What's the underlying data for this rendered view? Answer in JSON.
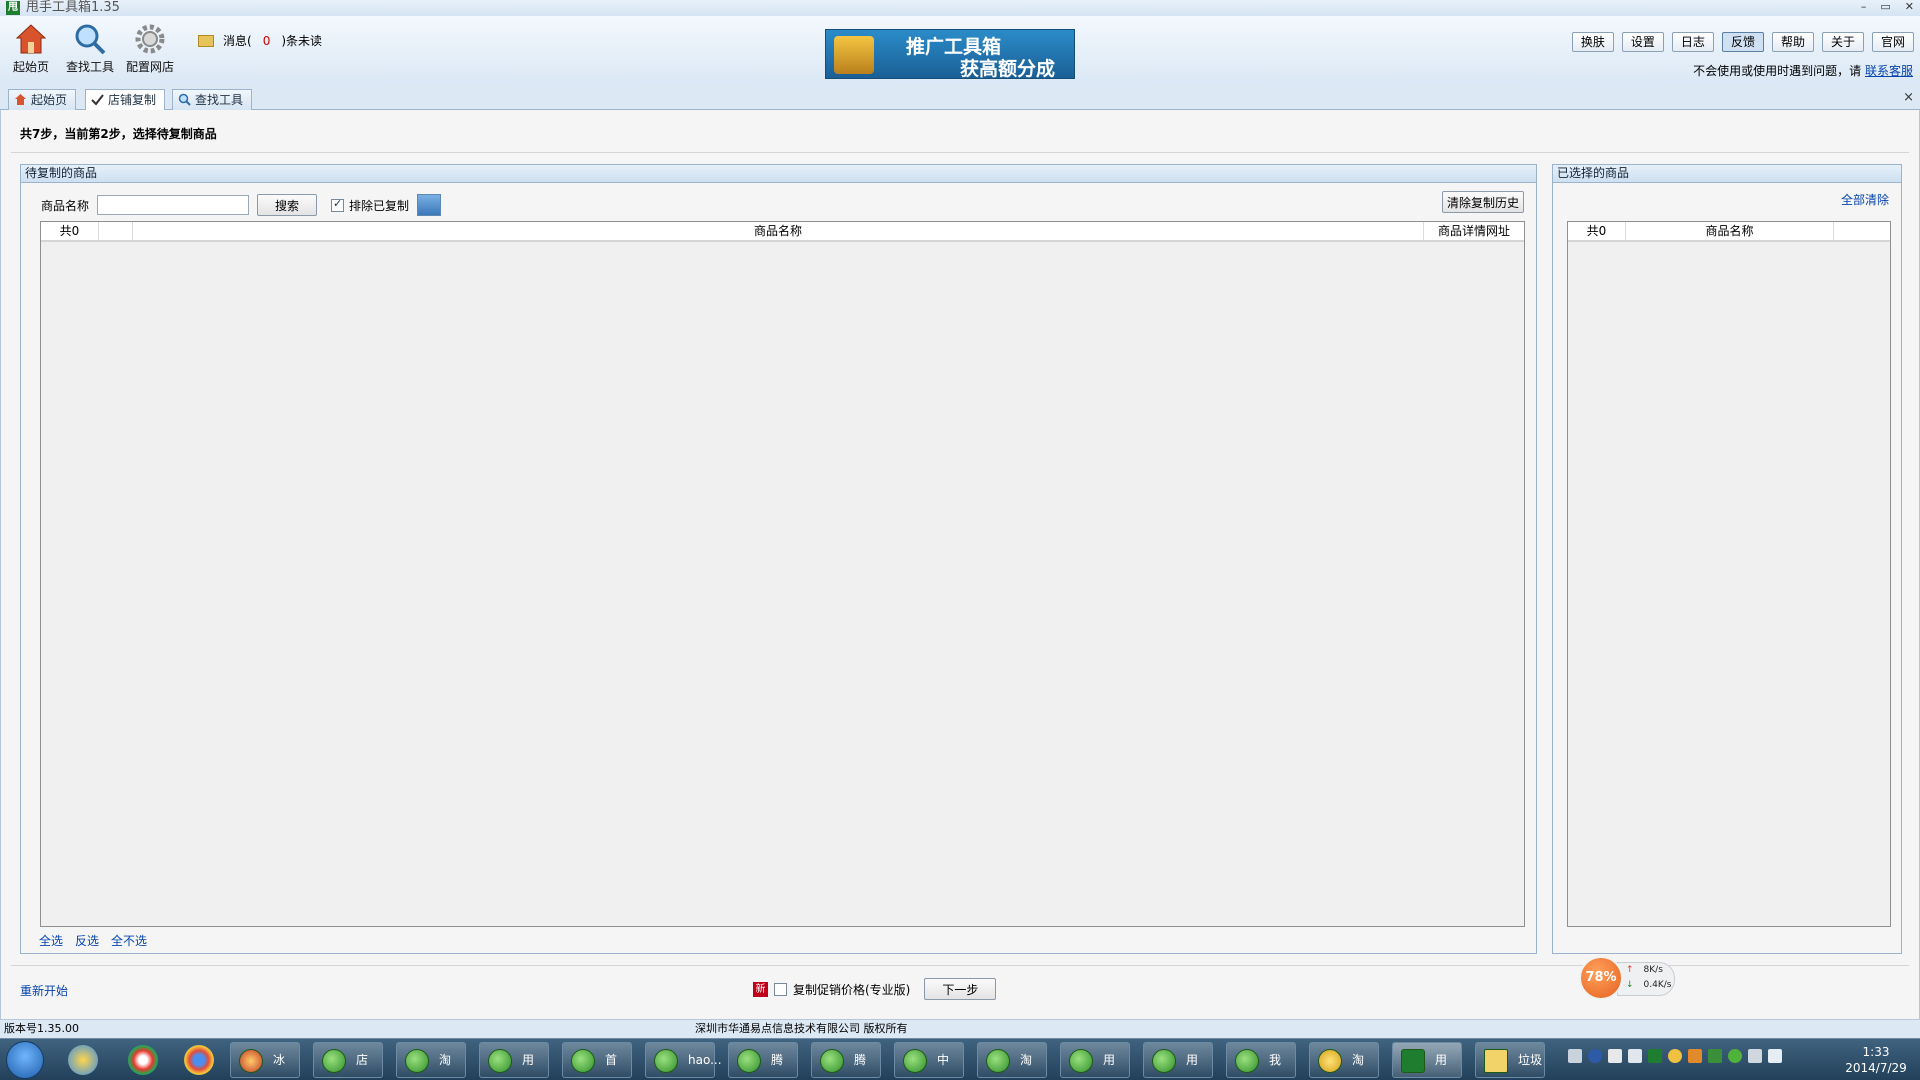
{
  "window": {
    "title": "甩手工具箱1.35",
    "logo_char": "甩",
    "minimize": "–",
    "maximize": "▭",
    "close": "✕"
  },
  "toolbar": {
    "home": "起始页",
    "find_tools": "查找工具",
    "config_shop": "配置网店",
    "msg_prefix": "消息(",
    "msg_count": "0",
    "msg_suffix": ")条未读"
  },
  "banner": {
    "line1": "推广工具箱",
    "line2": "获高额分成"
  },
  "top_buttons": {
    "skin": "换肤",
    "settings": "设置",
    "log": "日志",
    "feedback": "反馈",
    "help": "帮助",
    "about": "关于",
    "website": "官网"
  },
  "help_line": {
    "text": "不会使用或使用时遇到问题，请",
    "link": "联系客服"
  },
  "tabs": {
    "home": "起始页",
    "shop_copy": "店铺复制",
    "find_tools": "查找工具",
    "close": "×"
  },
  "step_text": "共7步，当前第2步，选择待复制商品",
  "left_panel": {
    "title": "待复制的商品",
    "name_label": "商品名称",
    "search_value": "",
    "search_btn": "搜索",
    "exclude_copied": "排除已复制",
    "clear_history_btn": "清除复制历史",
    "col_count": "共0",
    "col_name": "商品名称",
    "col_url": "商品详情网址",
    "select_all": "全选",
    "invert": "反选",
    "select_none": "全不选"
  },
  "right_panel": {
    "title": "已选择的商品",
    "clear_all": "全部清除",
    "col_count": "共0",
    "col_name": "商品名称"
  },
  "bottom": {
    "restart": "重新开始",
    "new_badge": "新",
    "copy_promo_price": "复制促销价格(专业版)",
    "next_btn": "下一步"
  },
  "speed": {
    "percent": "78%",
    "up": "8K/s",
    "down": "0.4K/s"
  },
  "statusbar": {
    "version": "版本号1.35.00",
    "copyright": "深圳市华通易点信息技术有限公司 版权所有"
  },
  "taskbar": {
    "tasks": [
      "冰洁...",
      "店内...",
      "淘宝...",
      "用手...",
      "首页...",
      "hao...",
      "腾讯...",
      "腾讯...",
      "中国...",
      "淘宝...",
      "用手...",
      "用手...",
      "我要...",
      "淘宝...",
      "用手...",
      "垃圾"
    ],
    "clock_time": "1:33",
    "clock_date": "2014/7/29"
  },
  "colors": {
    "accent": "#1e7d2f",
    "link": "#0645ad",
    "badge_red": "#c0001a",
    "speed_orange": "#e5611e"
  }
}
